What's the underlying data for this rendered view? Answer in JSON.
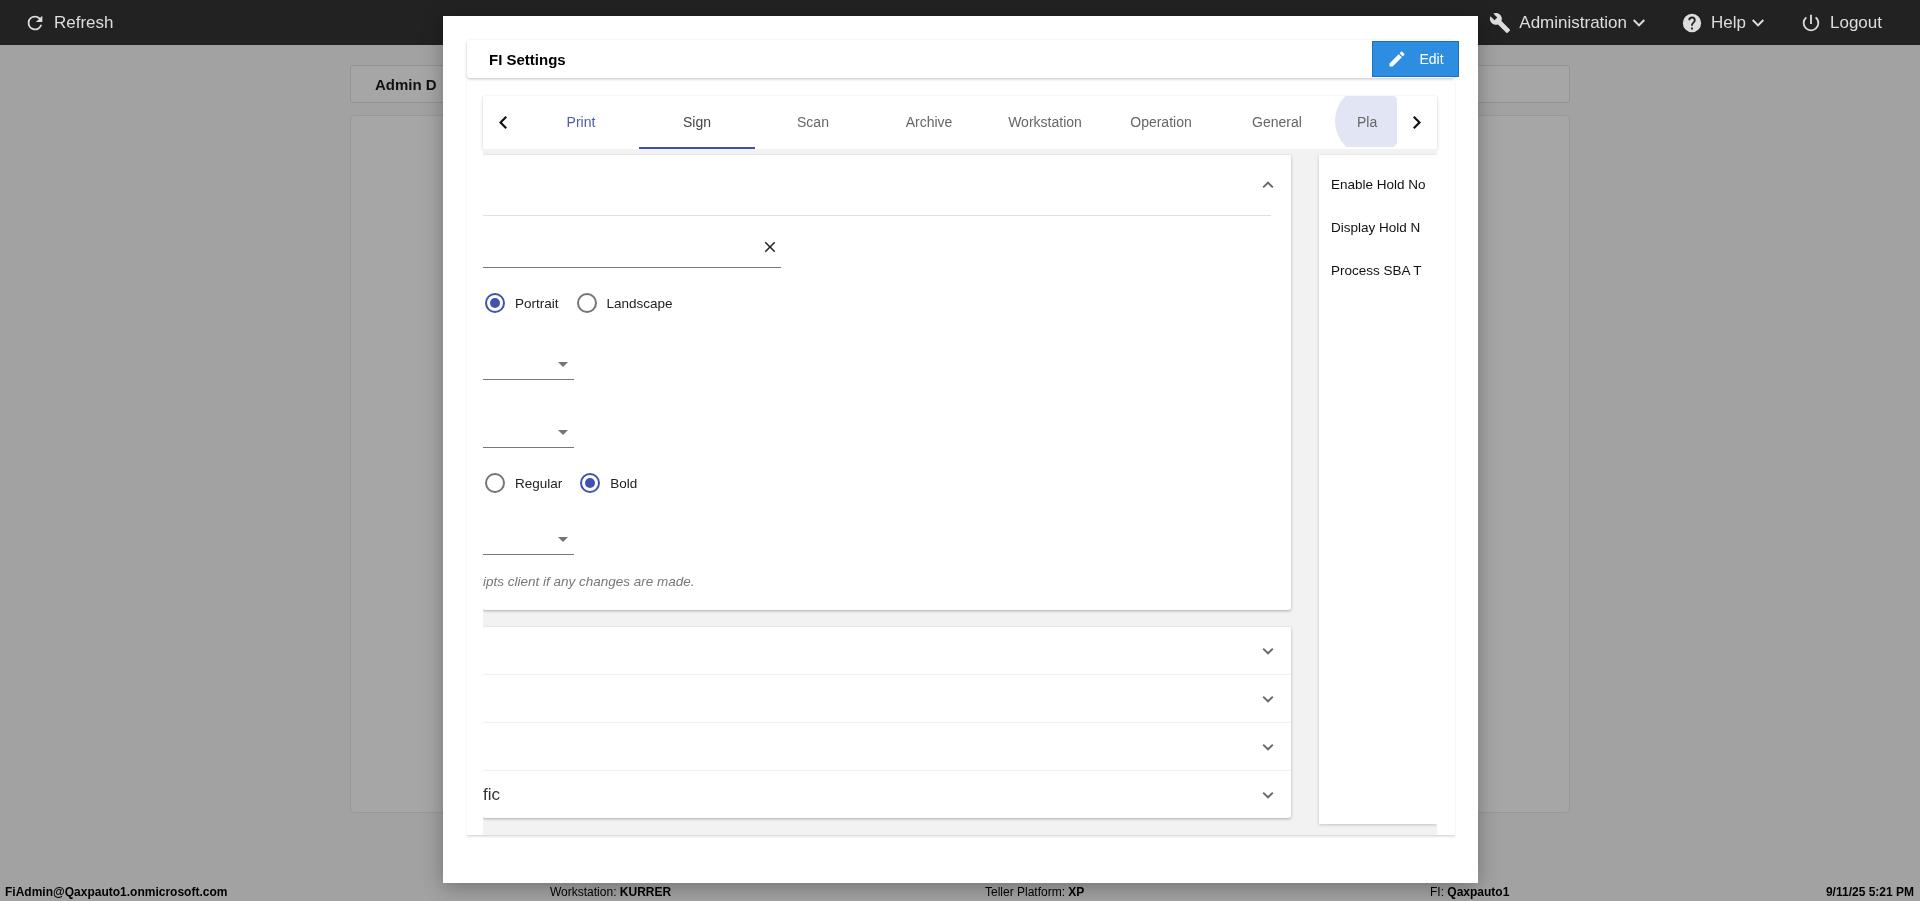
{
  "top_bar": {
    "refresh": "Refresh",
    "menus": [
      {
        "label": "Administration",
        "dropdown": true
      },
      {
        "label": "Help",
        "dropdown": true
      },
      {
        "label": "Logout",
        "dropdown": false
      }
    ]
  },
  "background": {
    "card_title": "Admin D"
  },
  "dialog": {
    "title": "FI Settings",
    "edit_button": "Edit",
    "tabs": [
      {
        "label": "Print",
        "selected": false,
        "focused": true,
        "pressed": false
      },
      {
        "label": "Sign",
        "selected": true,
        "focused": false,
        "pressed": false
      },
      {
        "label": "Scan",
        "selected": false,
        "focused": false,
        "pressed": false
      },
      {
        "label": "Archive",
        "selected": false,
        "focused": false,
        "pressed": false
      },
      {
        "label": "Workstation",
        "selected": false,
        "focused": false,
        "pressed": false
      },
      {
        "label": "Operation",
        "selected": false,
        "focused": false,
        "pressed": false
      },
      {
        "label": "General",
        "selected": false,
        "focused": false,
        "pressed": false
      },
      {
        "label": "Pla",
        "selected": false,
        "focused": false,
        "pressed": true
      }
    ],
    "print_panel": {
      "expanded": true,
      "fields": [
        {
          "kind": "text",
          "clearable": true
        },
        {
          "kind": "radio",
          "options": [
            {
              "label": "Portrait",
              "selected": true
            },
            {
              "label": "Landscape",
              "selected": false
            }
          ]
        },
        {
          "kind": "select"
        },
        {
          "kind": "select"
        },
        {
          "kind": "radio",
          "options": [
            {
              "label": "Regular",
              "selected": false
            },
            {
              "label": "Bold",
              "selected": true
            }
          ]
        },
        {
          "kind": "select"
        }
      ],
      "note": "ipts client if any changes are made."
    },
    "collapsed_panels": [
      {
        "expanded": false
      },
      {
        "expanded": false
      },
      {
        "expanded": false
      },
      {
        "title": "fic",
        "expanded": false
      }
    ],
    "side_options": [
      "Enable Hold No",
      "Display Hold N",
      "Process SBA T"
    ]
  },
  "status_bar": {
    "user": "FiAdmin@Qaxpauto1.onmicrosoft.com",
    "workstation_label": "Workstation:",
    "workstation": "KURRER",
    "platform_label": "Teller Platform:",
    "platform": "XP",
    "fi_label": "FI:",
    "fi": "Qaxpauto1",
    "datetime": "9/11/25 5:21 PM"
  }
}
